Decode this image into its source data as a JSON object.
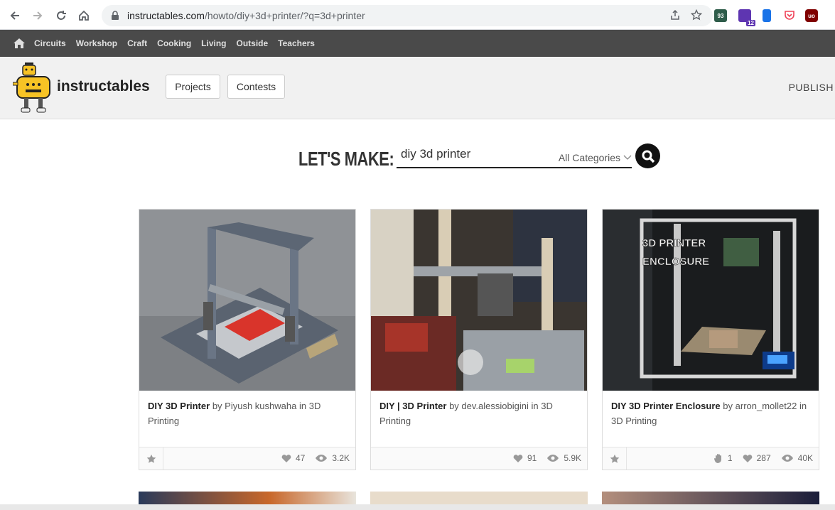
{
  "browser": {
    "url_host": "instructables.com",
    "url_path": "/howto/diy+3d+printer/?q=3d+printer",
    "ext_badge_1": "93",
    "ext_badge_2": "12"
  },
  "topnav": {
    "items": [
      "Circuits",
      "Workshop",
      "Craft",
      "Cooking",
      "Living",
      "Outside",
      "Teachers"
    ]
  },
  "header": {
    "logo_text": "instructables",
    "projects": "Projects",
    "contests": "Contests",
    "publish": "PUBLISH"
  },
  "search": {
    "lets_make": "LET'S MAKE:",
    "query": "diy 3d printer",
    "category": "All Categories"
  },
  "cards": [
    {
      "title": "DIY 3D Printer",
      "by": "by",
      "author": "Piyush kushwaha",
      "in": "in",
      "category": "3D Printing",
      "likes": "47",
      "views": "3.2K"
    },
    {
      "title": "DIY | 3D Printer",
      "by": "by",
      "author": "dev.alessiobigini",
      "in": "in",
      "category": "3D Printing",
      "likes": "91",
      "views": "5.9K"
    },
    {
      "title": "DIY 3D Printer Enclosure",
      "by": "by",
      "author": "arron_mollet22",
      "in": "in",
      "category": "3D Printing",
      "hands": "1",
      "likes": "287",
      "views": "40K",
      "overlay": "3D PRINTER ENCLOSURE"
    }
  ],
  "colors": {
    "nav_bg": "#4a4a4a",
    "header_bg": "#f1f1f1",
    "accent": "#111111"
  }
}
